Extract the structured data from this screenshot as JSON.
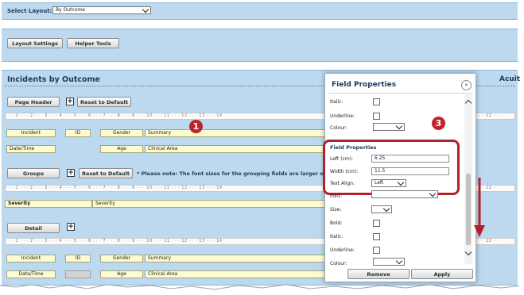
{
  "layout_select": {
    "label": "Select Layout:",
    "value": "By Outcome"
  },
  "toolbar": {
    "layout_settings": "Layout Settings",
    "helper_tools": "Helper Tools"
  },
  "report": {
    "title": "Incidents by Outcome",
    "acuity_label": "Acuit"
  },
  "page_header": {
    "button": "Page Header",
    "reset": "Reset to Default",
    "row1": [
      "Incident",
      "ID",
      "Gender",
      "Summary"
    ],
    "row2": [
      "Date/Time",
      "Age",
      "Clinical Area"
    ]
  },
  "groups": {
    "button": "Groups",
    "reset": "Reset to Default",
    "note": "* Please note: The font sizes for the grouping fields are larger on",
    "fields": [
      "Severity",
      "Severity"
    ]
  },
  "detail": {
    "button": "Detail",
    "row1": [
      "Incident",
      "ID",
      "Gender",
      "Summary"
    ],
    "row2": [
      "Date/Time",
      "Age",
      "Clinical Area"
    ]
  },
  "ruler": {
    "text": "· · · 1 · · · 2 · · · 3 · · · 4 · · · 5 · · · 6 · · · 7 · · · 8 · · · 9 · · · 10 · · · 11 · · · 12 · · · 13 · · · 14",
    "tail": "1 · · 22 · ·"
  },
  "field_properties": {
    "title": "Field Properties",
    "italic": "Italic:",
    "underline": "Underline:",
    "colour": "Colour:",
    "section_title": "Field Properties",
    "left_label": "Left (cm):",
    "left_value": "6.25",
    "width_label": "Width (cm):",
    "width_value": "11.5",
    "align_label": "Text Align:",
    "align_value": "Left",
    "font": "Font:",
    "size": "Size:",
    "bold": "Bold:",
    "italic2": "Italic:",
    "underline2": "Underline:",
    "colour2": "Colour:",
    "remove": "Remove",
    "apply": "Apply"
  },
  "callouts": {
    "one": "1",
    "three": "3"
  },
  "colors": {
    "band": "#bcd9ef",
    "field": "#fffbd1",
    "accent_red": "#c0242b"
  }
}
